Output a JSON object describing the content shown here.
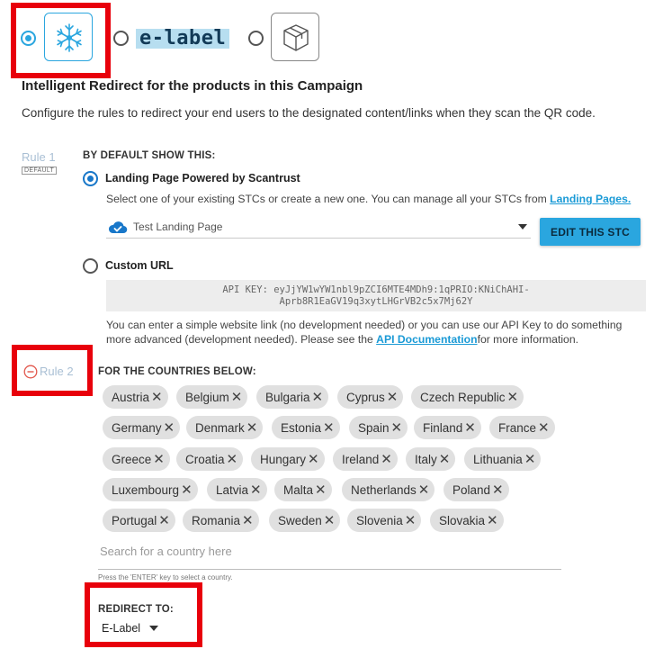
{
  "type_selector": {
    "options": [
      {
        "name": "snowflake",
        "icon": "snowflake-icon",
        "selected": true
      },
      {
        "name": "e-label",
        "label": "e-label",
        "selected": false
      },
      {
        "name": "package",
        "icon": "box-icon",
        "selected": false
      }
    ]
  },
  "header": {
    "title": "Intelligent Redirect for the products in this Campaign",
    "subtitle": "Configure the rules to redirect your end users to the designated content/links when they scan the QR code."
  },
  "rule1": {
    "label": "Rule 1",
    "tag": "DEFAULT",
    "heading": "BY DEFAULT SHOW THIS:",
    "landing_option": {
      "label": "Landing Page Powered by Scantrust",
      "selected": true,
      "description": "Select one of your existing STCs or create a new one. You can manage all your STCs from ",
      "link_text": "Landing Pages."
    },
    "stc_select": {
      "value": "Test Landing Page",
      "icon": "cloud-check-icon"
    },
    "edit_button": "EDIT THIS STC",
    "custom_url_option": {
      "label": "Custom URL",
      "selected": false
    },
    "api_key_line1": "API KEY: eyJjYW1wYW1nbl9pZCI6MTE4MDh9:1qPRIO:KNiChAHI-",
    "api_key_line2": "Aprb8R1EaGV19q3xytLHGrVB2c5x7Mj62Y",
    "api_description_1": "You can enter a simple website link (no development needed) or you can use our API Key to do something",
    "api_description_2_pre": "more advanced (development needed). Please see the ",
    "api_link_text": "API Documentation",
    "api_description_2_post": "for more information."
  },
  "rule2": {
    "label": "Rule 2",
    "remove_icon": "minus-circle-icon",
    "heading": "FOR THE COUNTRIES BELOW:",
    "countries": [
      "Austria",
      "Belgium",
      "Bulgaria",
      "Cyprus",
      "Czech Republic",
      "Germany",
      "Denmark",
      "Estonia",
      "Spain",
      "Finland",
      "France",
      "Greece",
      "Croatia",
      "Hungary",
      "Ireland",
      "Italy",
      "Lithuania",
      "Luxembourg",
      "Latvia",
      "Malta",
      "Netherlands",
      "Poland",
      "Portugal",
      "Romania",
      "Sweden",
      "Slovenia",
      "Slovakia"
    ],
    "chip_remove_glyph": "✕",
    "search_placeholder": "Search for a country here",
    "search_hint": "Press the 'ENTER' key to select a country.",
    "redirect_heading": "REDIRECT TO:",
    "redirect_value": "E-Label"
  },
  "colors": {
    "accent": "#2aa6df",
    "highlight_red": "#e8000b",
    "chip_bg": "#e0e0e0",
    "remove_red": "#e2574c"
  }
}
